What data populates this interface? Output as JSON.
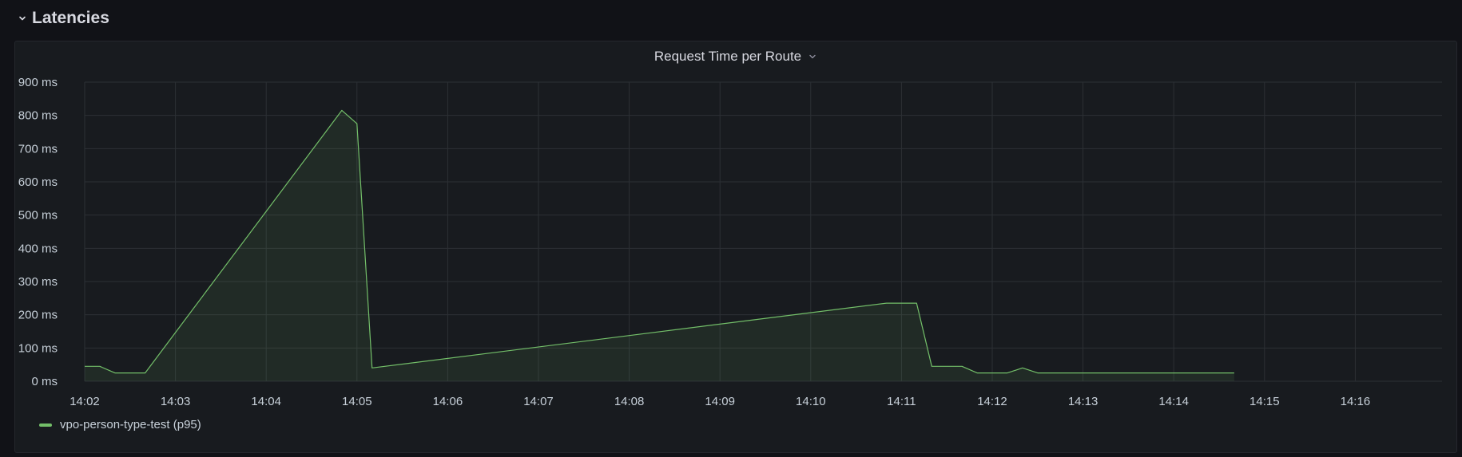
{
  "row": {
    "title": "Latencies",
    "icon": "chevron-down-icon"
  },
  "panel": {
    "title": "Request Time per Route",
    "menu_icon": "chevron-down-icon"
  },
  "colors": {
    "background": "#111217",
    "panel": "#181b1f",
    "series": "#73bf69",
    "grid": "#2c3035",
    "text": "#c7d0d9"
  },
  "chart_data": {
    "type": "area",
    "title": "Request Time per Route",
    "xlabel": "",
    "ylabel": "",
    "x_ticks": [
      "14:02",
      "14:03",
      "14:04",
      "14:05",
      "14:06",
      "14:07",
      "14:08",
      "14:09",
      "14:10",
      "14:11",
      "14:12",
      "14:13",
      "14:14",
      "14:15",
      "14:16"
    ],
    "y_ticks": [
      "0 ms",
      "100 ms",
      "200 ms",
      "300 ms",
      "400 ms",
      "500 ms",
      "600 ms",
      "700 ms",
      "800 ms",
      "900 ms"
    ],
    "xlim": [
      "14:02:00",
      "14:16:45"
    ],
    "ylim": [
      0,
      900
    ],
    "grid": true,
    "legend_position": "bottom-left",
    "series": [
      {
        "name": "vpo-person-type-test (p95)",
        "color": "#73bf69",
        "x": [
          "14:02:00",
          "14:02:10",
          "14:02:20",
          "14:02:40",
          "14:04:50",
          "14:05:00",
          "14:05:10",
          "14:10:50",
          "14:11:00",
          "14:11:10",
          "14:11:20",
          "14:11:40",
          "14:11:50",
          "14:12:10",
          "14:12:20",
          "14:12:30",
          "14:14:40"
        ],
        "values": [
          45,
          45,
          25,
          25,
          815,
          775,
          40,
          235,
          235,
          235,
          45,
          45,
          25,
          25,
          40,
          25,
          25
        ]
      }
    ]
  }
}
